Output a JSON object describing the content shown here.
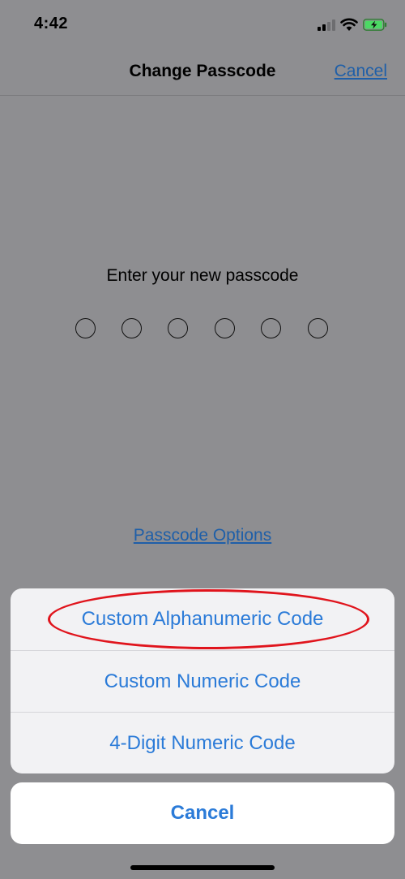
{
  "status_bar": {
    "time": "4:42",
    "signal_icon": "cellular-signal-icon",
    "wifi_icon": "wifi-icon",
    "battery_icon": "battery-charging-icon",
    "battery_color": "#4cd964"
  },
  "nav": {
    "title": "Change Passcode",
    "cancel_label": "Cancel"
  },
  "prompt": "Enter your new passcode",
  "passcode_length": 6,
  "passcode_options_label": "Passcode Options",
  "action_sheet": {
    "items": [
      {
        "label": "Custom Alphanumeric Code",
        "highlighted": true
      },
      {
        "label": "Custom Numeric Code"
      },
      {
        "label": "4-Digit Numeric Code"
      }
    ],
    "cancel_label": "Cancel"
  },
  "colors": {
    "accent": "#2b7bd8",
    "highlight": "#e0141c",
    "dim_background": "#8e8e91"
  }
}
